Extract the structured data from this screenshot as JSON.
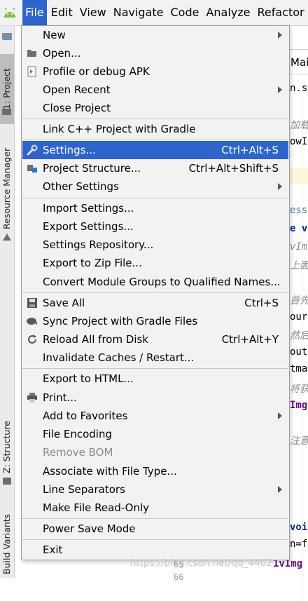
{
  "menubar": {
    "items": [
      "File",
      "Edit",
      "View",
      "Navigate",
      "Code",
      "Analyze",
      "Refactor"
    ],
    "active": "File"
  },
  "toolwindows": {
    "project": "1: Project",
    "resource_manager": "Resource Manager",
    "structure": "Z: Structure",
    "build_variants": "Build Variants"
  },
  "editor": {
    "tab_label": "Main",
    "fragments": [
      "n.se",
      "加载",
      "owIm",
      "essL",
      "e vo",
      "vIm",
      "上面",
      "首先",
      "our",
      "然后",
      "outS",
      "tmap",
      "将获",
      "Img.",
      "注意",
      "voi",
      "n=fi",
      "1vImg",
      "65",
      "66"
    ]
  },
  "file_menu": {
    "new": "New",
    "open": "Open...",
    "profile_apk": "Profile or debug APK",
    "open_recent": "Open Recent",
    "close_project": "Close Project",
    "link_cpp": "Link C++ Project with Gradle",
    "settings": "Settings...",
    "settings_shortcut": "Ctrl+Alt+S",
    "project_structure": "Project Structure...",
    "project_structure_shortcut": "Ctrl+Alt+Shift+S",
    "other_settings": "Other Settings",
    "import_settings": "Import Settings...",
    "export_settings": "Export Settings...",
    "settings_repository": "Settings Repository...",
    "export_zip": "Export to Zip File...",
    "convert_module": "Convert Module Groups to Qualified Names...",
    "save_all": "Save All",
    "save_all_shortcut": "Ctrl+S",
    "sync_gradle": "Sync Project with Gradle Files",
    "reload_disk": "Reload All from Disk",
    "reload_disk_shortcut": "Ctrl+Alt+Y",
    "invalidate": "Invalidate Caches / Restart...",
    "export_html": "Export to HTML...",
    "print": "Print...",
    "add_favorites": "Add to Favorites",
    "file_encoding": "File Encoding",
    "remove_bom": "Remove BOM",
    "associate_type": "Associate with File Type...",
    "line_separators": "Line Separators",
    "make_readonly": "Make File Read-Only",
    "power_save": "Power Save Mode",
    "exit": "Exit"
  },
  "watermark": "https://blog.csdn.net/qq_4462",
  "colors": {
    "highlight": "#2f65ca",
    "menu_bg": "#f2f2f2"
  }
}
